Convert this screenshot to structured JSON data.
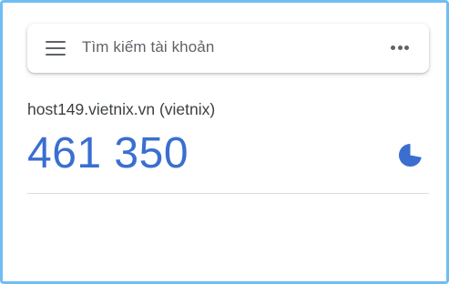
{
  "search": {
    "placeholder": "Tìm kiếm tài khoản",
    "menu_icon": "hamburger-menu-icon",
    "more_icon": "more-horizontal-icon"
  },
  "account": {
    "label": "host149.vietnix.vn (vietnix)",
    "code": "461 350",
    "timer_icon": "countdown-pie-icon",
    "timer_fraction_remaining": 0.72
  },
  "colors": {
    "accent": "#3a6fd0",
    "frame_border": "#6fbef2",
    "icon_gray": "#5f6368",
    "divider": "#dadce0"
  }
}
